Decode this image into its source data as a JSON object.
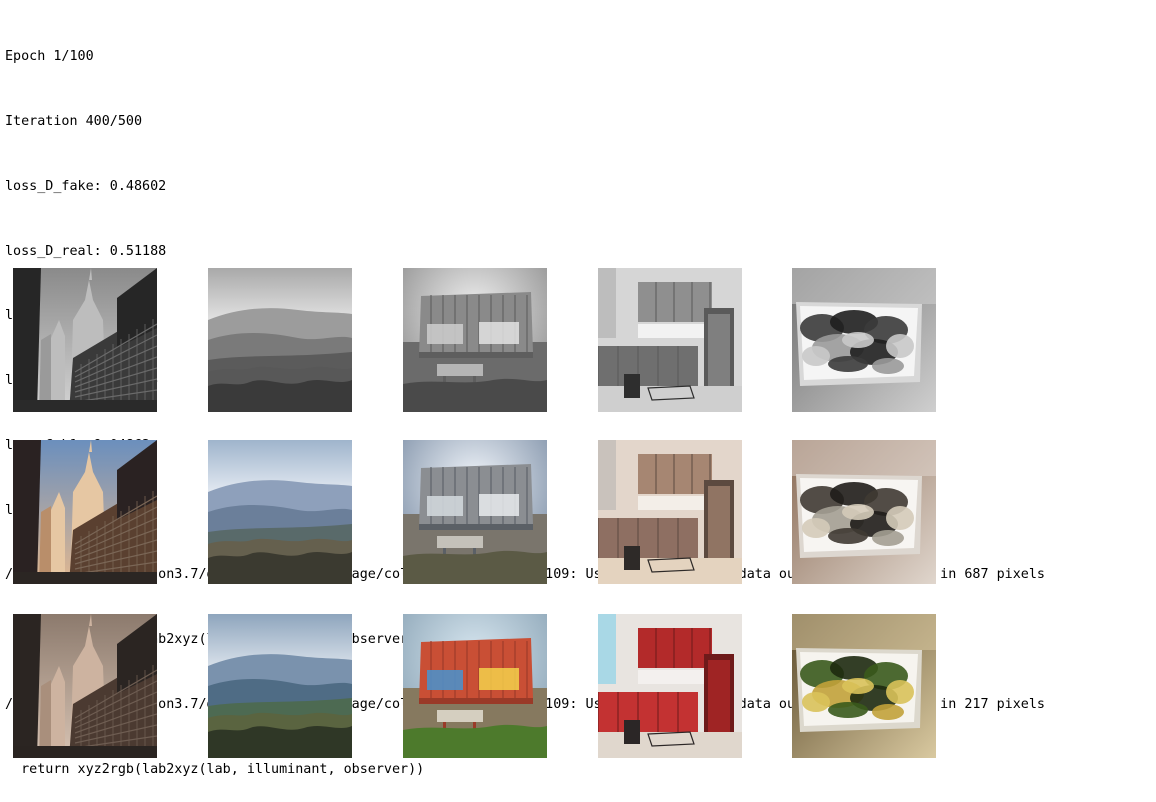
{
  "output": {
    "lines": [
      "Epoch 1/100",
      "Iteration 400/500",
      "loss_D_fake: 0.48602",
      "loss_D_real: 0.51188",
      "loss_D: 0.49895",
      "loss_G_GAN: 1.45143",
      "loss_G_L1: 9.04862",
      "loss_G: 10.50005",
      "/usr/local/lib/python3.7/dist-packages/skimage/color/colorconv.py:1109: UserWarning: Color data out of range: Z < 0 in 687 pixels",
      "  return xyz2rgb(lab2xyz(lab, illuminant, observer))",
      "/usr/local/lib/python3.7/dist-packages/skimage/color/colorconv.py:1109: UserWarning: Color data out of range: Z < 0 in 217 pixels",
      "  return xyz2rgb(lab2xyz(lab, illuminant, observer))"
    ]
  },
  "image_grid": {
    "rows": [
      "grayscale-input",
      "predicted-color",
      "real-color"
    ],
    "scenes": [
      "city-skyscrapers",
      "mountain-landscape",
      "freight-boxcar",
      "modern-kitchen",
      "food-bowl"
    ]
  }
}
